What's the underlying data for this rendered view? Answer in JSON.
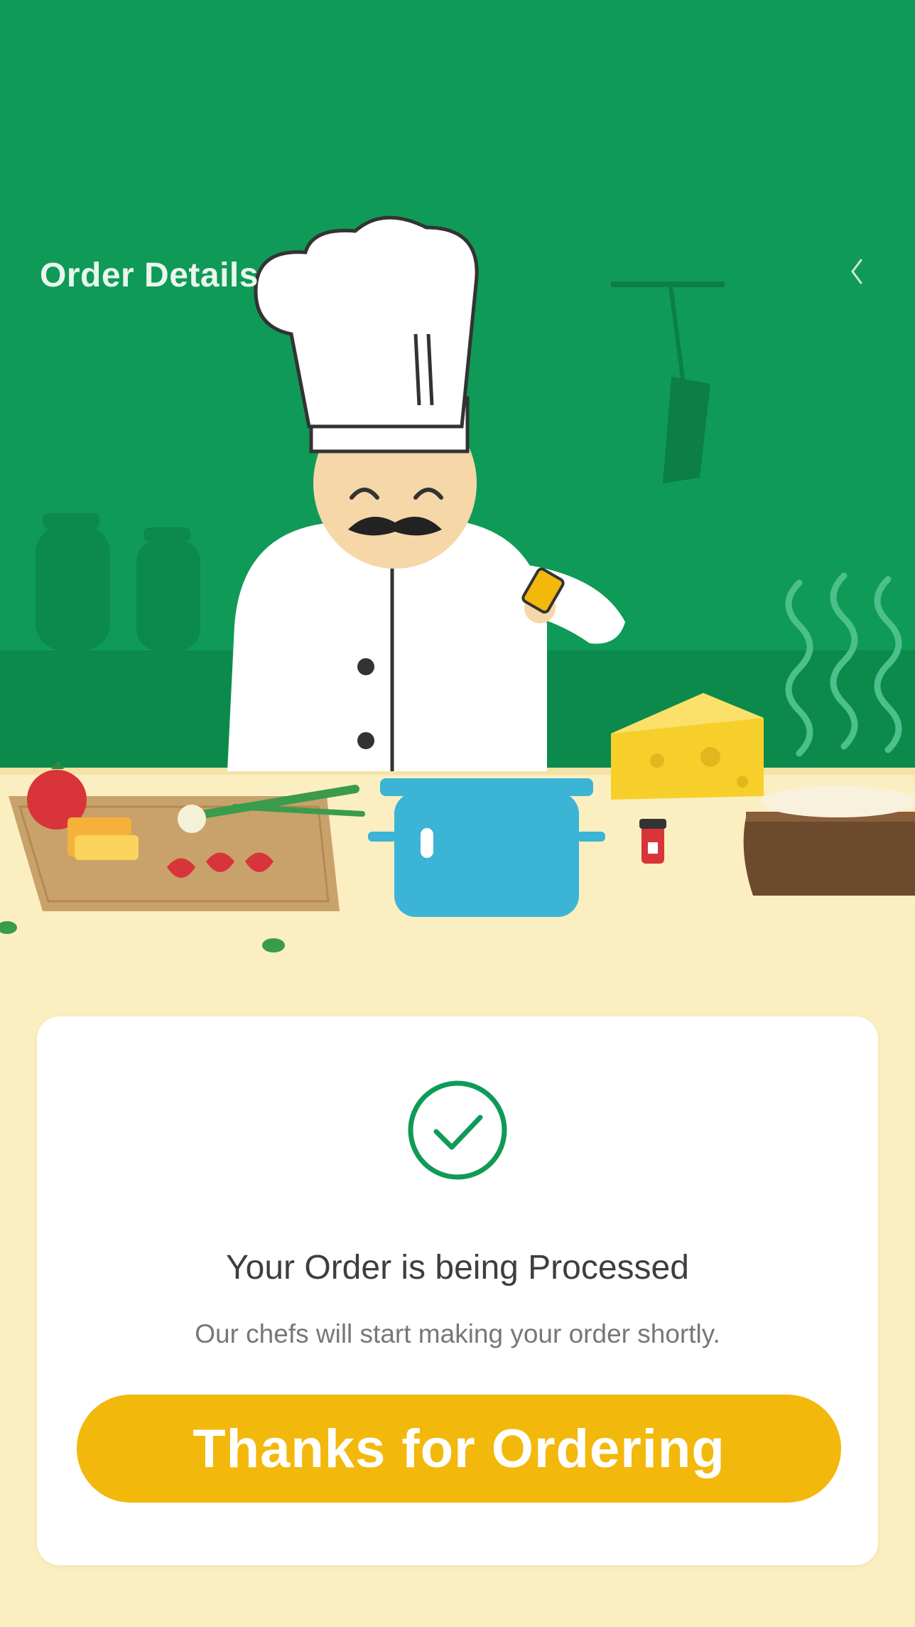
{
  "header": {
    "title": "Order Details",
    "back_icon": "chevron-left-icon"
  },
  "illustration": {
    "icon": "chef-cooking-illustration",
    "colors": {
      "background": "#0f9a57",
      "counter": "#fbeec0",
      "pot": "#3bb4d6",
      "cheese": "#f6cf2a"
    }
  },
  "status": {
    "icon": "check-circle-icon",
    "title": "Your Order is being Processed",
    "subtitle": "Our chefs will start making your order shortly."
  },
  "cta": {
    "label": "Thanks for Ordering",
    "color": "#f3b80c"
  }
}
